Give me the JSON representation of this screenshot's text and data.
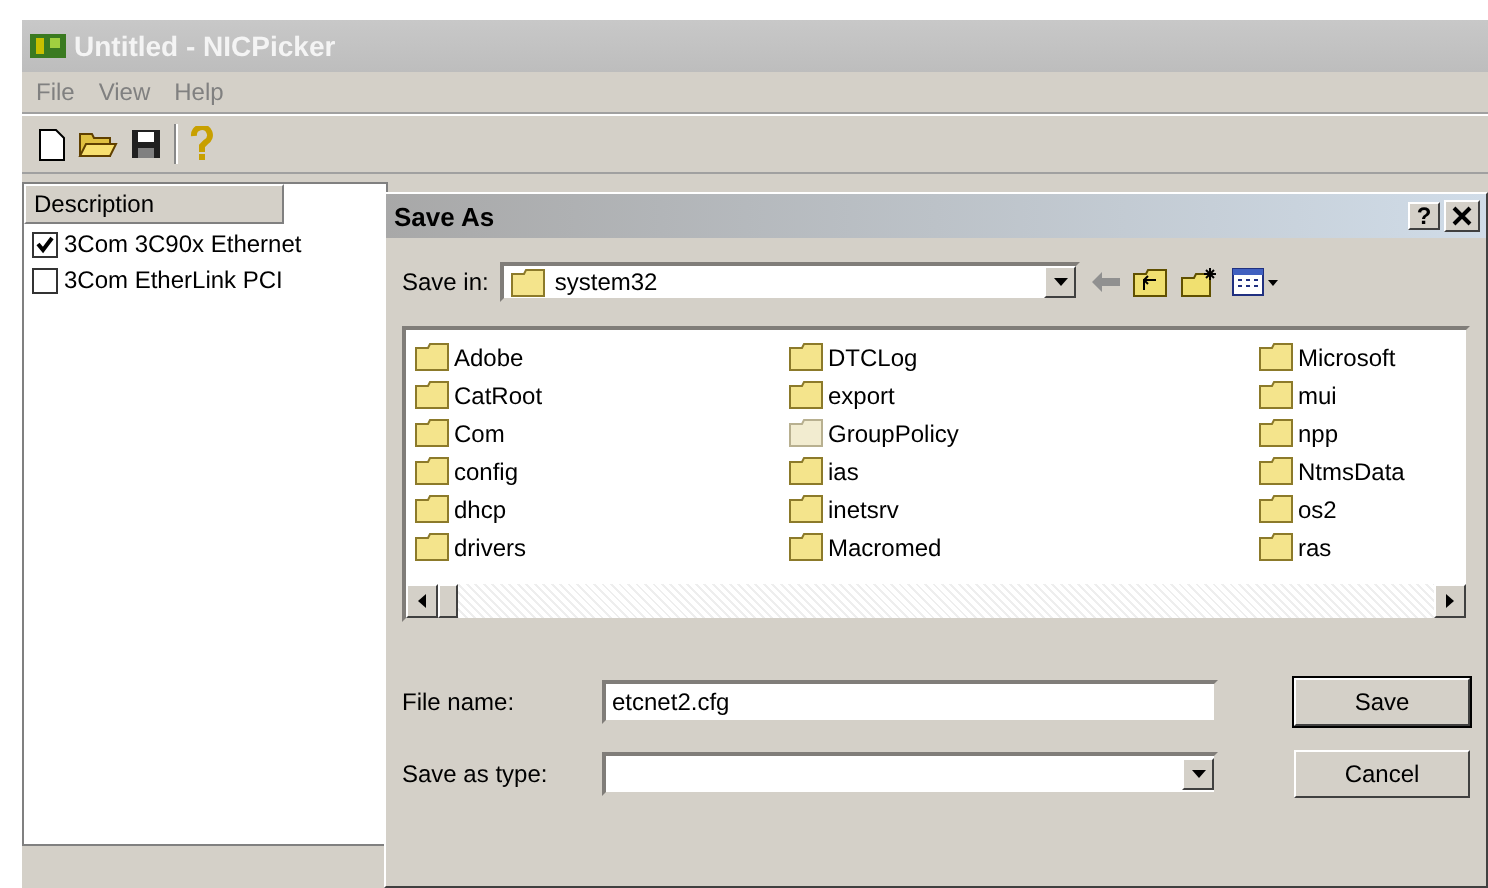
{
  "app": {
    "title": "Untitled - NICPicker",
    "menu": [
      "File",
      "View",
      "Help"
    ],
    "list": {
      "header": "Description",
      "items": [
        {
          "label": "3Com 3C90x Ethernet",
          "checked": true
        },
        {
          "label": "3Com EtherLink PCI",
          "checked": false
        }
      ]
    }
  },
  "dialog": {
    "title": "Save As",
    "help_button": "?",
    "save_in": {
      "label": "Save in:",
      "value": "system32"
    },
    "folders": [
      {
        "name": "Adobe",
        "hidden": false
      },
      {
        "name": "CatRoot",
        "hidden": false
      },
      {
        "name": "Com",
        "hidden": false
      },
      {
        "name": "config",
        "hidden": false
      },
      {
        "name": "dhcp",
        "hidden": false
      },
      {
        "name": "drivers",
        "hidden": false
      },
      {
        "name": "DTCLog",
        "hidden": false
      },
      {
        "name": "export",
        "hidden": false
      },
      {
        "name": "GroupPolicy",
        "hidden": true
      },
      {
        "name": "ias",
        "hidden": false
      },
      {
        "name": "inetsrv",
        "hidden": false
      },
      {
        "name": "Macromed",
        "hidden": false
      },
      {
        "name": "Microsoft",
        "hidden": false
      },
      {
        "name": "mui",
        "hidden": false
      },
      {
        "name": "npp",
        "hidden": false
      },
      {
        "name": "NtmsData",
        "hidden": false
      },
      {
        "name": "os2",
        "hidden": false
      },
      {
        "name": "ras",
        "hidden": false
      }
    ],
    "file_name": {
      "label": "File name:",
      "value": "etcnet2.cfg"
    },
    "save_as_type": {
      "label": "Save as type:"
    },
    "buttons": [
      {
        "label": "Save",
        "default": true
      },
      {
        "label": "Cancel",
        "default": false
      }
    ]
  }
}
